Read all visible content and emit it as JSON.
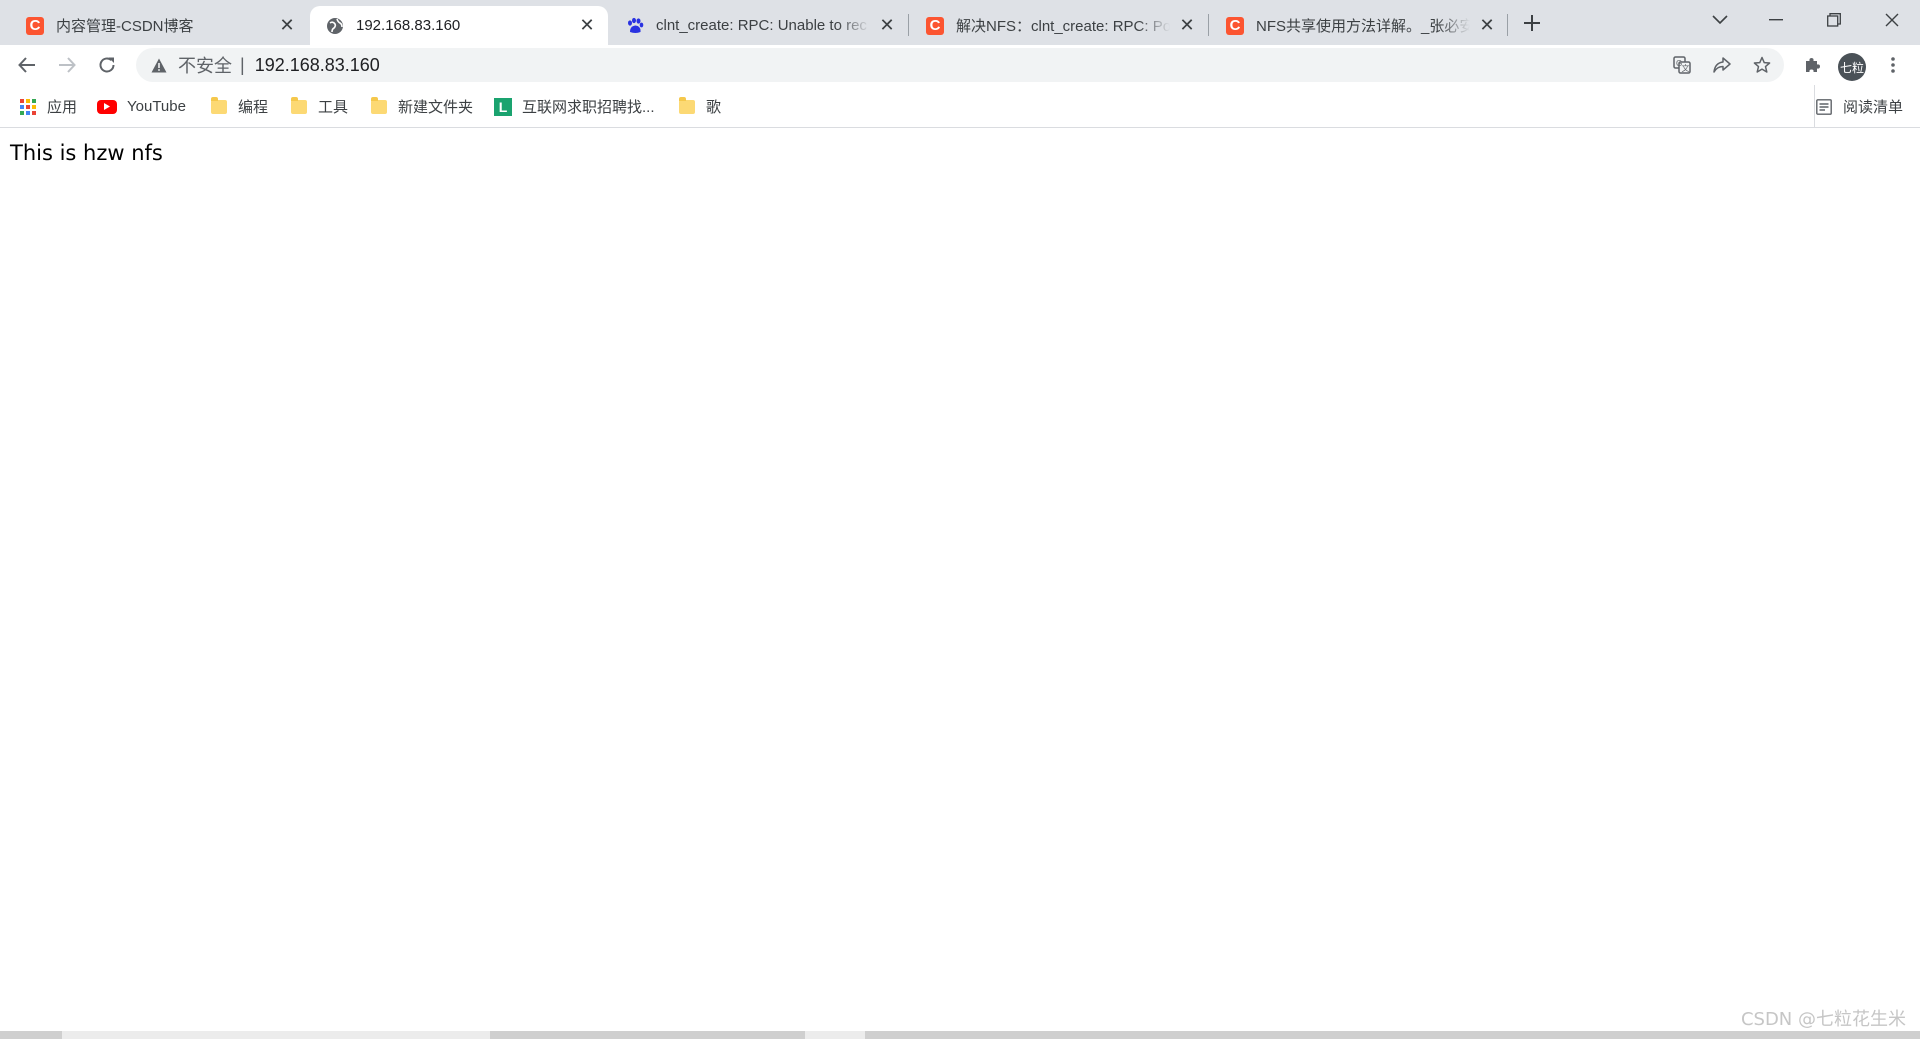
{
  "tabs": [
    {
      "title": "内容管理-CSDN博客",
      "favicon": "csdn-icon",
      "active": false
    },
    {
      "title": "192.168.83.160",
      "favicon": "globe-icon",
      "active": true
    },
    {
      "title": "clnt_create: RPC: Unable to rec",
      "favicon": "baidu-paw-icon",
      "active": false
    },
    {
      "title": "解决NFS：clnt_create: RPC: Por",
      "favicon": "csdn-icon",
      "active": false
    },
    {
      "title": "NFS共享使用方法详解。_张必安",
      "favicon": "csdn-icon",
      "active": false
    }
  ],
  "toolbar": {
    "security_label": "不安全",
    "separator": "|",
    "url": "192.168.83.160",
    "avatar_text": "七粒"
  },
  "bookmarks": {
    "apps_label": "应用",
    "items": [
      {
        "label": "YouTube",
        "icon": "youtube-icon"
      },
      {
        "label": "编程",
        "icon": "folder-icon"
      },
      {
        "label": "工具",
        "icon": "folder-icon"
      },
      {
        "label": "新建文件夹",
        "icon": "folder-icon"
      },
      {
        "label": "互联网求职招聘找...",
        "icon": "liepin-icon"
      },
      {
        "label": "歌",
        "icon": "folder-icon"
      }
    ],
    "reading_list_label": "阅读清单"
  },
  "page": {
    "body_text": "This is hzw nfs"
  },
  "watermark": "CSDN @七粒花生米",
  "colors": {
    "tabstrip": "#dee1e6",
    "csdn_red": "#fc5531",
    "youtube_red": "#ff0000",
    "folder_yellow": "#fcd974",
    "liepin_green": "#1aa36f"
  }
}
